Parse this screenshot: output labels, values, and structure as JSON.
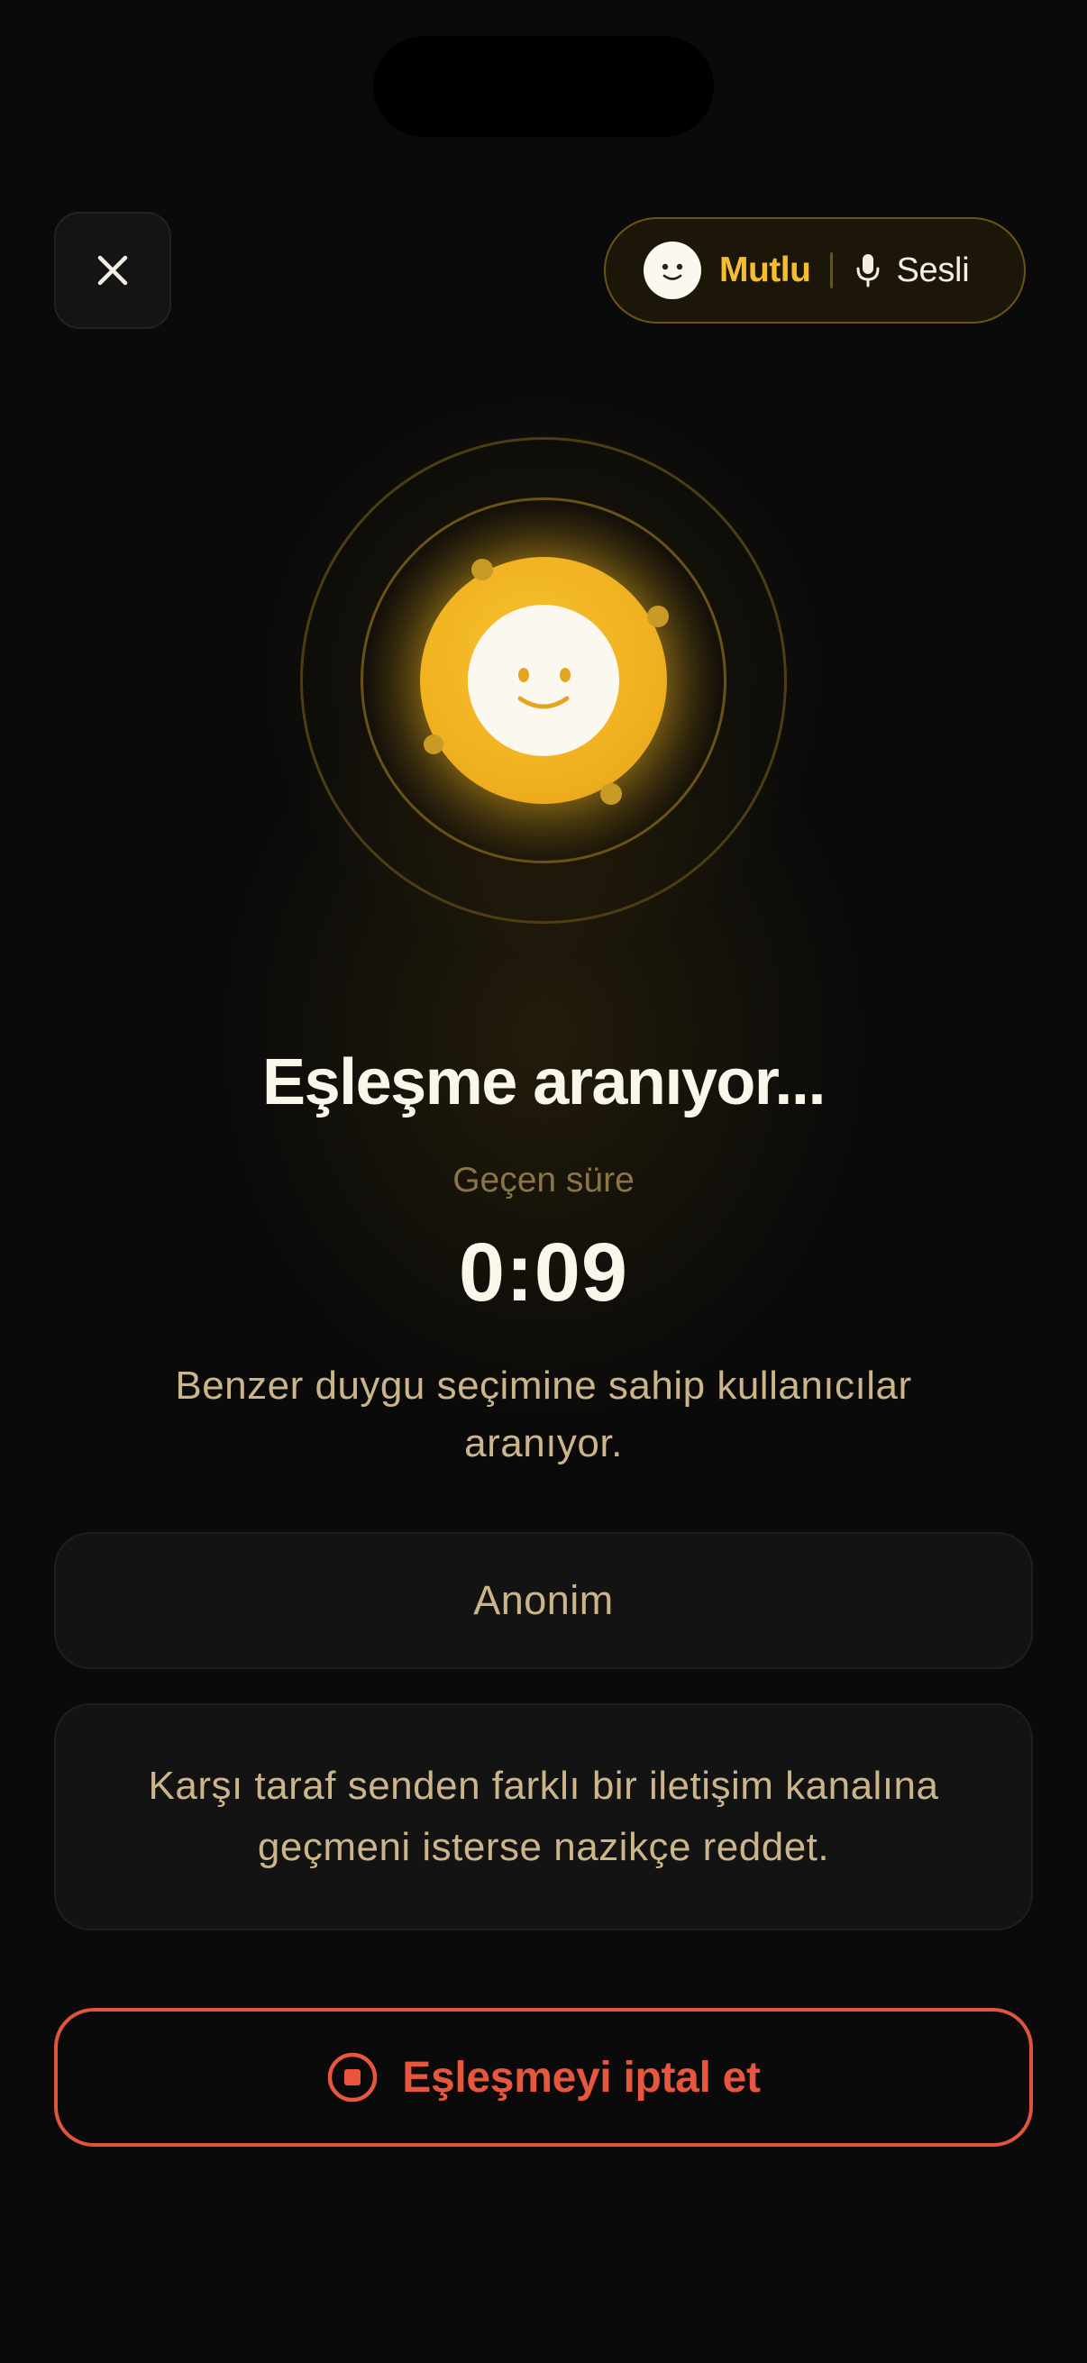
{
  "header": {
    "close_icon": "close-icon",
    "mode": {
      "emotion_icon": "smiley-face-icon",
      "emotion": "Mutlu",
      "channel_icon": "microphone-icon",
      "channel": "Sesli"
    }
  },
  "matching": {
    "avatar_icon": "smiley-face-icon",
    "title": "Eşleşme aranıyor...",
    "elapsed_label": "Geçen süre",
    "elapsed_time": "0:09",
    "description": "Benzer duygu seçimine sahip kullanıcılar aranıyor."
  },
  "cards": {
    "anonymity": "Anonim",
    "tip": "Karşı taraf senden farklı bir iletişim kanalına geçmeni isterse nazikçe reddet."
  },
  "cancel": {
    "icon": "stop-circle-icon",
    "label": "Eşleşmeyi iptal et"
  },
  "colors": {
    "background": "#0a0a0a",
    "accent": "#f6bd2c",
    "danger": "#e8573d",
    "muted_text": "#cdb58a"
  }
}
